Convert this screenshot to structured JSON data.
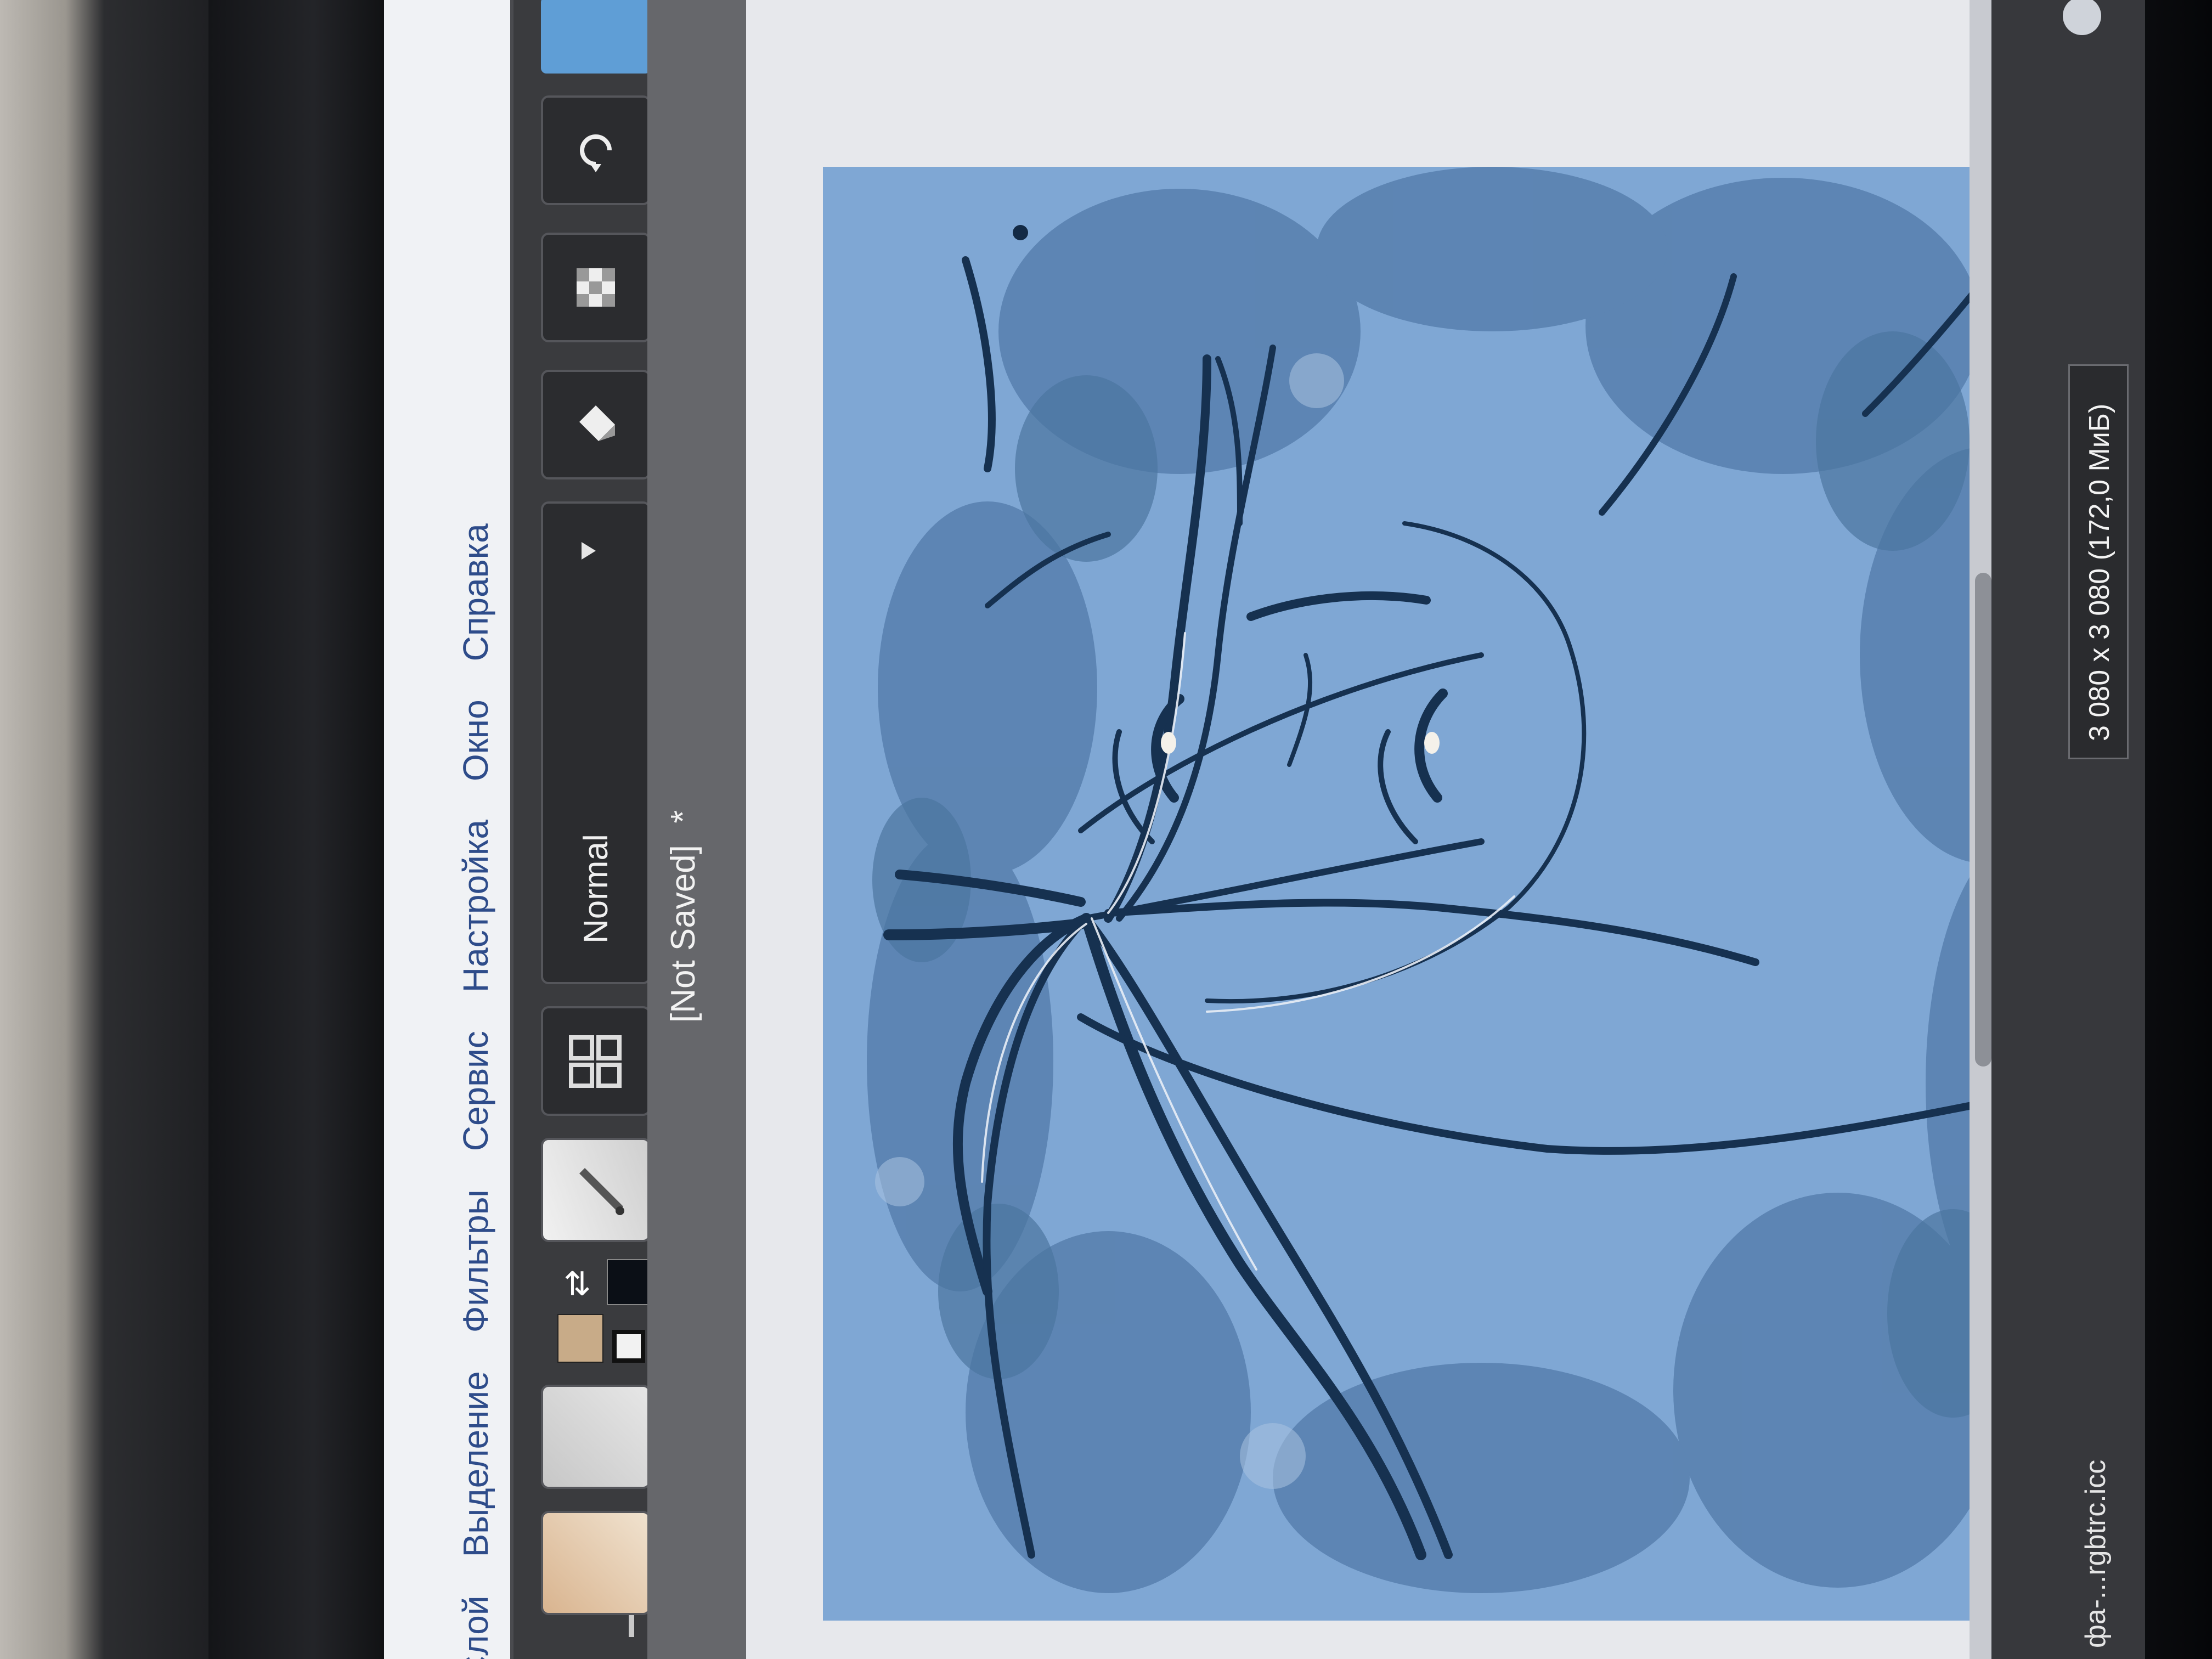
{
  "menu": {
    "items": [
      "Слой",
      "Выделение",
      "Фильтры",
      "Сервис",
      "Настройка",
      "Окно",
      "Справка"
    ]
  },
  "toolbar": {
    "blend_mode": "Normal",
    "icons": [
      "brush-preset-icon",
      "grid-preset-icon",
      "dropdown-arrow-icon",
      "eraser-icon",
      "alpha-lock-icon",
      "reset-icon"
    ]
  },
  "document": {
    "title": "[Not Saved]",
    "modified_marker": "*"
  },
  "status": {
    "color_profile": "фа-...rgbtrc.icc",
    "image_size": "3 080 x 3 080 (172,0 МиБ)"
  },
  "colors": {
    "foreground": "#0b0f16",
    "background": "#f2f2f2",
    "brush_color": "#c8ab88",
    "canvas_bg": "#7ea6d3",
    "foliage": "#5b83b0",
    "ink": "#16314f"
  }
}
